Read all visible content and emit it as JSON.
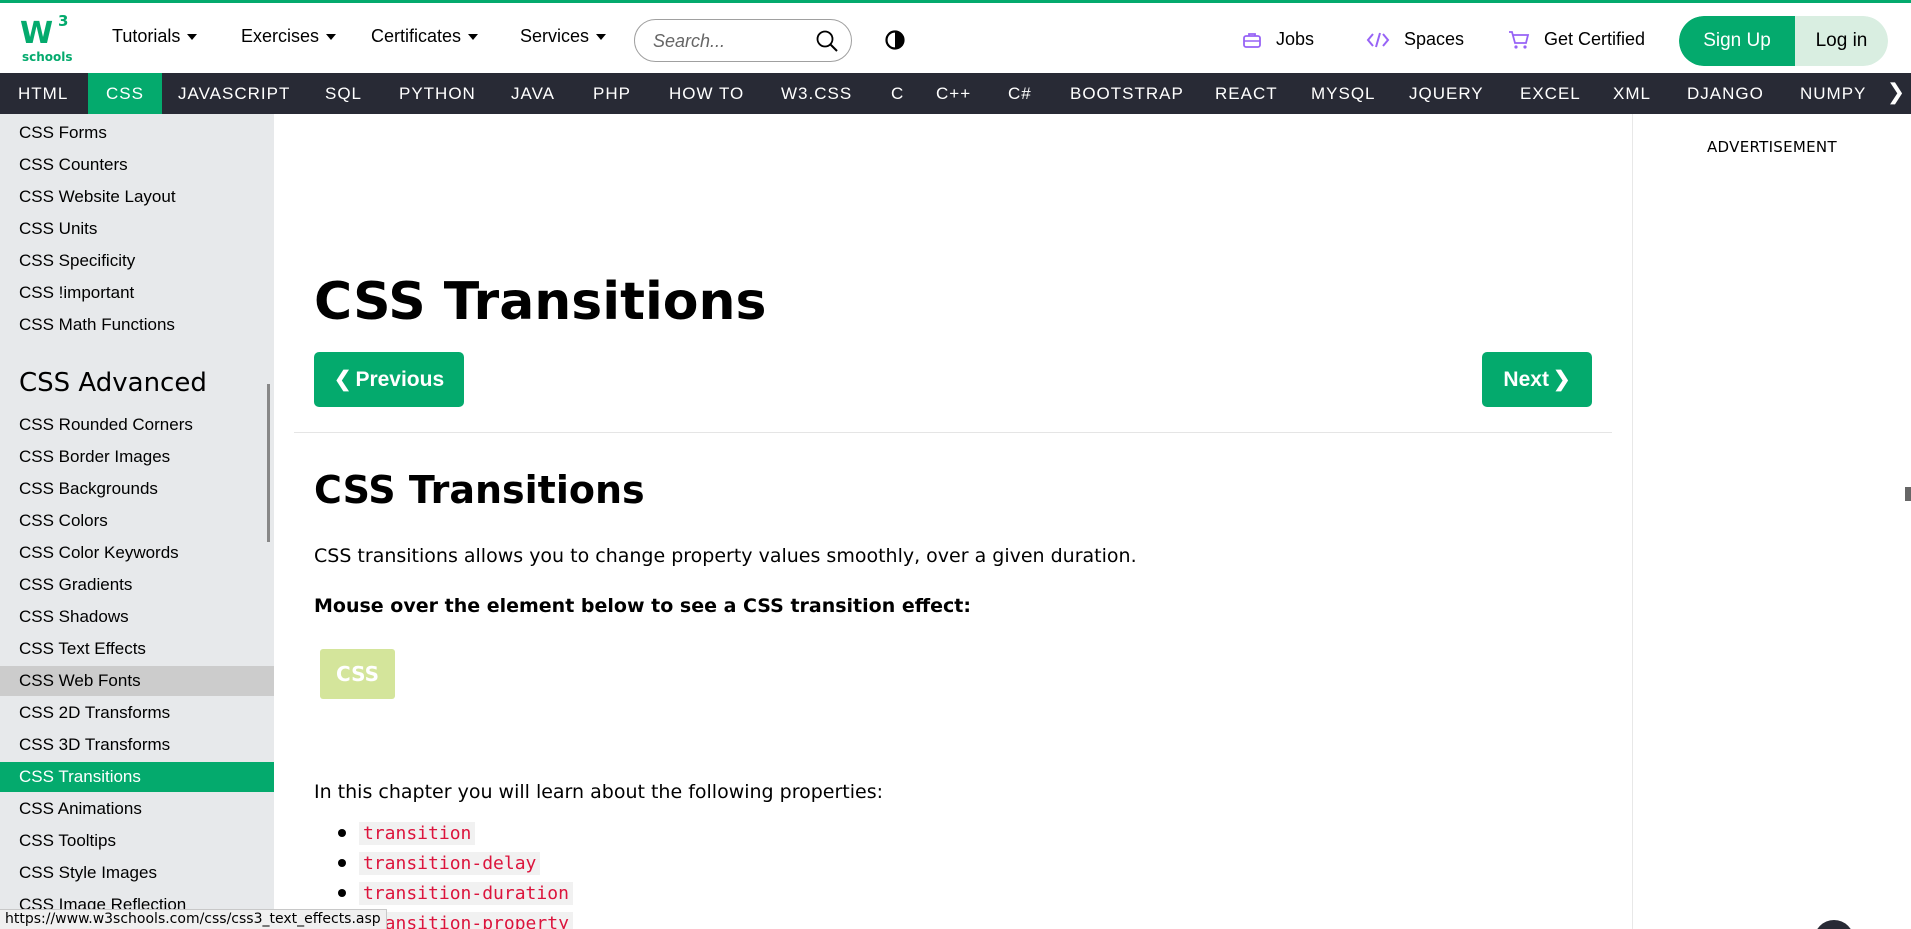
{
  "logo": {
    "main": "W",
    "sup": "3",
    "sub": "schools"
  },
  "topnav": {
    "menus": [
      {
        "label": "Tutorials"
      },
      {
        "label": "Exercises"
      },
      {
        "label": "Certificates"
      },
      {
        "label": "Services"
      }
    ],
    "search_placeholder": "Search...",
    "jobs": "Jobs",
    "spaces": "Spaces",
    "get_certified": "Get Certified",
    "sign_up": "Sign Up",
    "log_in": "Log in"
  },
  "topics": [
    "HTML",
    "CSS",
    "JAVASCRIPT",
    "SQL",
    "PYTHON",
    "JAVA",
    "PHP",
    "HOW TO",
    "W3.CSS",
    "C",
    "C++",
    "C#",
    "BOOTSTRAP",
    "REACT",
    "MYSQL",
    "JQUERY",
    "EXCEL",
    "XML",
    "DJANGO",
    "NUMPY"
  ],
  "active_topic": "CSS",
  "sidebar": {
    "items_top": [
      "CSS Forms",
      "CSS Counters",
      "CSS Website Layout",
      "CSS Units",
      "CSS Specificity",
      "CSS !important",
      "CSS Math Functions"
    ],
    "heading": "CSS Advanced",
    "items_advanced": [
      "CSS Rounded Corners",
      "CSS Border Images",
      "CSS Backgrounds",
      "CSS Colors",
      "CSS Color Keywords",
      "CSS Gradients",
      "CSS Shadows",
      "CSS Text Effects",
      "CSS Web Fonts",
      "CSS 2D Transforms",
      "CSS 3D Transforms",
      "CSS Transitions",
      "CSS Animations",
      "CSS Tooltips",
      "CSS Style Images",
      "CSS Image Reflection"
    ],
    "hovered": "CSS Web Fonts",
    "active": "CSS Transitions"
  },
  "main": {
    "title": "CSS Transitions",
    "prev": "Previous",
    "next": "Next",
    "h2": "CSS Transitions",
    "intro": "CSS transitions allows you to change property values smoothly, over a given duration.",
    "demo_prompt": "Mouse over the element below to see a CSS transition effect:",
    "demo_label": "CSS",
    "chapter_intro": "In this chapter you will learn about the following properties:",
    "properties": [
      "transition",
      "transition-delay",
      "transition-duration",
      "transition-property"
    ]
  },
  "ad": {
    "label": "ADVERTISEMENT"
  },
  "status_url": "https://www.w3schools.com/css/css3_text_effects.asp",
  "colors": {
    "brand": "#04AA6D",
    "dark": "#282A35",
    "sidebar": "#E7E9EB",
    "code": "#DC143C"
  }
}
